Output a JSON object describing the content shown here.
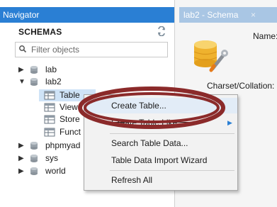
{
  "navigator": {
    "title": "Navigator",
    "schemas_label": "SCHEMAS",
    "filter_placeholder": "Filter objects",
    "tree": [
      {
        "label": "lab",
        "expanded": false
      },
      {
        "label": "lab2",
        "expanded": true
      },
      {
        "label": "Table"
      },
      {
        "label": "View"
      },
      {
        "label": "Store"
      },
      {
        "label": "Funct"
      },
      {
        "label": "phpmyad",
        "expanded": false
      },
      {
        "label": "sys",
        "expanded": false
      },
      {
        "label": "world",
        "expanded": false
      }
    ]
  },
  "editor": {
    "tab_title": "lab2 - Schema",
    "tab_close": "×",
    "name_label": "Name:",
    "charset_label": "Charset/Collation:"
  },
  "context_menu": {
    "items": [
      {
        "label": "Create Table..."
      },
      {
        "label": "Create Table Like",
        "has_submenu": true
      },
      {
        "label": "Search Table Data..."
      },
      {
        "label": "Table Data Import Wizard"
      },
      {
        "label": "Refresh All"
      }
    ]
  },
  "colors": {
    "header_blue": "#2a7fd4",
    "annotation_ellipse": "#8b2a2a"
  },
  "icons": {
    "refresh": "refresh-icon",
    "search": "search-icon",
    "database": "database-icon",
    "folder": "table-folder-icon",
    "logo": "schema-logo-icon"
  }
}
